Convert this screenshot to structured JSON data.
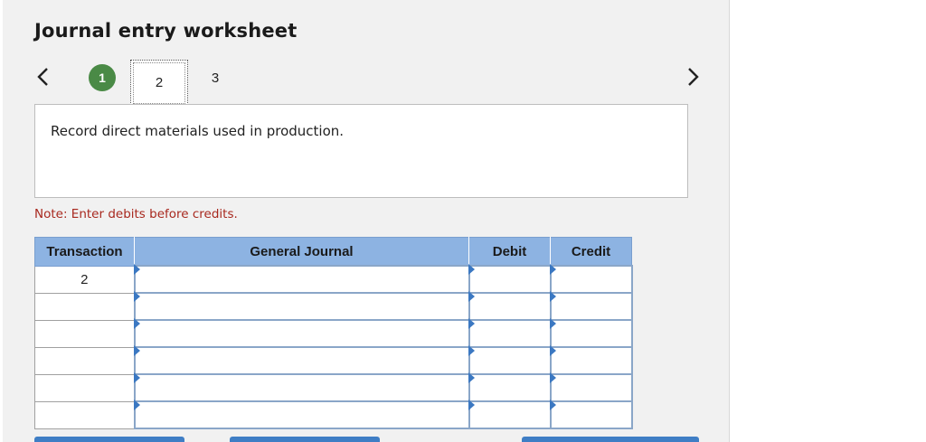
{
  "title": "Journal entry worksheet",
  "steps": {
    "prev_icon": "chevron-left-icon",
    "next_icon": "chevron-right-icon",
    "items": [
      {
        "label": "1",
        "state": "completed"
      },
      {
        "label": "2",
        "state": "current"
      },
      {
        "label": "3",
        "state": "pending"
      }
    ]
  },
  "prompt": "Record direct materials used in production.",
  "note": "Note: Enter debits before credits.",
  "table": {
    "headers": [
      "Transaction",
      "General Journal",
      "Debit",
      "Credit"
    ],
    "rows": [
      {
        "transaction": "2",
        "general_journal": "",
        "debit": "",
        "credit": ""
      },
      {
        "transaction": "",
        "general_journal": "",
        "debit": "",
        "credit": ""
      },
      {
        "transaction": "",
        "general_journal": "",
        "debit": "",
        "credit": ""
      },
      {
        "transaction": "",
        "general_journal": "",
        "debit": "",
        "credit": ""
      },
      {
        "transaction": "",
        "general_journal": "",
        "debit": "",
        "credit": ""
      },
      {
        "transaction": "",
        "general_journal": "",
        "debit": "",
        "credit": ""
      }
    ]
  },
  "colors": {
    "header_bg": "#8db3e2",
    "completed_step": "#4a8a46",
    "note_text": "#a8281e",
    "button_blue": "#3f7ec5"
  }
}
